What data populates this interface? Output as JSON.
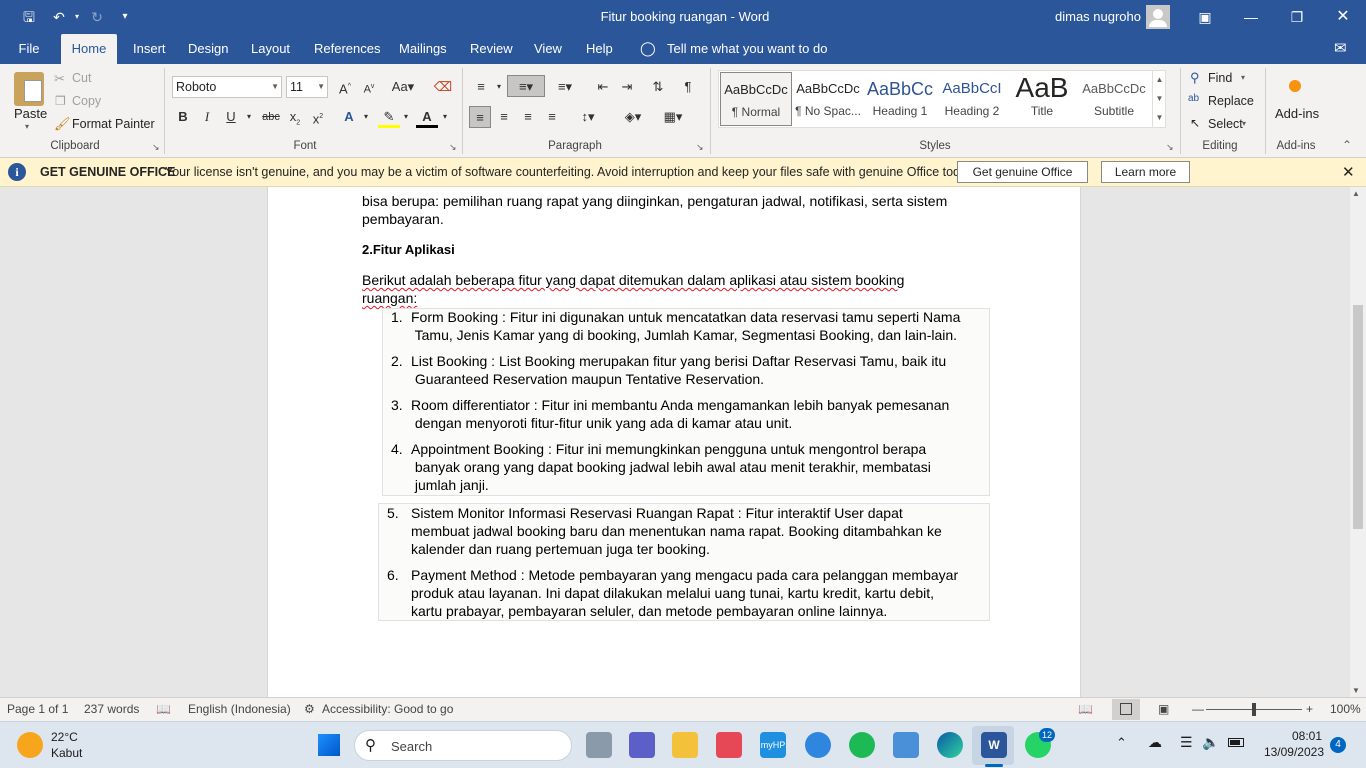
{
  "titlebar": {
    "title": "Fitur booking  ruangan  -  Word",
    "user": "dimas nugroho"
  },
  "tabs": [
    "File",
    "Home",
    "Insert",
    "Design",
    "Layout",
    "References",
    "Mailings",
    "Review",
    "View",
    "Help"
  ],
  "tell_me": "Tell me what you want to do",
  "ribbon": {
    "clipboard": {
      "paste": "Paste",
      "cut": "Cut",
      "copy": "Copy",
      "format_painter": "Format Painter",
      "label": "Clipboard"
    },
    "font": {
      "name": "Roboto",
      "size": "11",
      "label": "Font"
    },
    "paragraph": {
      "label": "Paragraph"
    },
    "styles": {
      "label": "Styles",
      "items": [
        {
          "preview": "AaBbCcDc",
          "name": "¶ Normal"
        },
        {
          "preview": "AaBbCcDc",
          "name": "¶ No Spac..."
        },
        {
          "preview": "AaBbCc",
          "name": "Heading 1"
        },
        {
          "preview": "AaBbCcI",
          "name": "Heading 2"
        },
        {
          "preview": "AaB",
          "name": "Title"
        },
        {
          "preview": "AaBbCcDc",
          "name": "Subtitle"
        }
      ]
    },
    "editing": {
      "find": "Find",
      "replace": "Replace",
      "select": "Select",
      "label": "Editing"
    },
    "addins": {
      "button": "Add-ins",
      "label": "Add-ins"
    }
  },
  "banner": {
    "title": "GET GENUINE OFFICE",
    "message": "Your license isn't genuine, and you may be a victim of software counterfeiting. Avoid interruption and keep your files safe with genuine Office today.",
    "btn_genuine": "Get genuine Office",
    "btn_learn": "Learn more"
  },
  "document": {
    "intro_line1": "bisa berupa: pemilihan ruang rapat yang diinginkan, pengaturan jadwal, notifikasi, serta sistem",
    "intro_line2": "pembayaran.",
    "heading": "2.Fitur Aplikasi",
    "lead_line1": "Berikut adalah beberapa fitur yang dapat ditemukan dalam aplikasi atau sistem booking",
    "lead_line2": "ruangan:",
    "items": [
      {
        "num": "1.",
        "lines": [
          "Form Booking : Fitur ini digunakan untuk mencatatkan data reservasi tamu seperti Nama",
          " Tamu, Jenis Kamar yang di booking, Jumlah Kamar, Segmentasi Booking, dan lain-lain."
        ]
      },
      {
        "num": "2.",
        "lines": [
          "List Booking : List Booking merupakan fitur yang berisi Daftar Reservasi Tamu, baik itu",
          " Guaranteed Reservation maupun Tentative Reservation."
        ]
      },
      {
        "num": "3.",
        "lines": [
          "Room differentiator : Fitur ini membantu Anda mengamankan lebih banyak pemesanan",
          " dengan menyoroti fitur-fitur unik yang ada di kamar atau unit."
        ]
      },
      {
        "num": "4.",
        "lines": [
          "Appointment Booking : Fitur ini memungkinkan pengguna untuk mengontrol berapa",
          " banyak orang yang dapat booking jadwal lebih awal atau menit terakhir, membatasi",
          " jumlah janji."
        ]
      },
      {
        "num": "5.",
        "lines": [
          "Sistem Monitor Informasi Reservasi Ruangan Rapat : Fitur interaktif User dapat",
          "membuat jadwal booking baru dan menentukan nama rapat. Booking ditambahkan ke",
          "kalender dan ruang pertemuan juga ter booking."
        ]
      },
      {
        "num": "6.",
        "lines": [
          "Payment Method : Metode pembayaran yang mengacu pada cara pelanggan membayar",
          "produk atau layanan. Ini dapat dilakukan melalui uang tunai, kartu kredit, kartu debit,",
          "kartu prabayar, pembayaran seluler, dan metode pembayaran online lainnya."
        ]
      }
    ]
  },
  "status": {
    "page": "Page 1 of 1",
    "words": "237 words",
    "language": "English (Indonesia)",
    "accessibility": "Accessibility: Good to go",
    "zoom": "100%"
  },
  "taskbar": {
    "temp": "22°C",
    "weather": "Kabut",
    "search": "Search",
    "time": "08:01",
    "date": "13/09/2023",
    "notif_count": "4",
    "whatsapp_badge": "12"
  },
  "colors": {
    "word_blue": "#2b579a",
    "banner_bg": "#fff4ce",
    "spell_red": "#e81123"
  }
}
